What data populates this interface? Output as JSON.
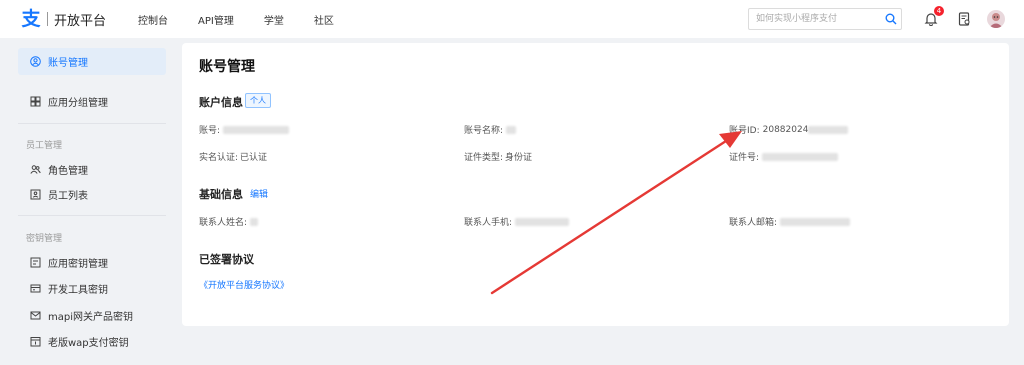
{
  "header": {
    "app_title": "开放平台",
    "nav": [
      "控制台",
      "API管理",
      "学堂",
      "社区"
    ],
    "search_placeholder": "如何实现小程序支付",
    "notification_count": "4",
    "icons": [
      "search-icon",
      "bell-icon",
      "document-icon",
      "avatar"
    ]
  },
  "sidebar": {
    "items_top": [
      {
        "label": "账号管理",
        "icon": "user-circle-icon",
        "active": true
      },
      {
        "label": "应用分组管理",
        "icon": "grid-icon",
        "active": false
      }
    ],
    "group1_title": "员工管理",
    "group1_items": [
      {
        "label": "角色管理",
        "icon": "people-icon"
      },
      {
        "label": "员工列表",
        "icon": "id-card-icon"
      }
    ],
    "group2_title": "密钥管理",
    "group2_items": [
      {
        "label": "应用密钥管理",
        "icon": "key-doc-icon"
      },
      {
        "label": "开发工具密钥",
        "icon": "tool-icon"
      },
      {
        "label": "mapi网关产品密钥",
        "icon": "mail-icon"
      },
      {
        "label": "老版wap支付密钥",
        "icon": "calendar-icon"
      }
    ]
  },
  "main": {
    "title": "账号管理",
    "account_section": {
      "title": "账户信息",
      "tag": "个人",
      "account_label": "账号:",
      "account_name_label": "账号名称:",
      "account_id_label": "账号ID:",
      "account_id_value": "20882024",
      "realname_label": "实名认证:",
      "realname_value": "已认证",
      "cert_type_label": "证件类型:",
      "cert_type_value": "身份证",
      "cert_no_label": "证件号:"
    },
    "basic_section": {
      "title": "基础信息",
      "edit": "编辑",
      "contact_name_label": "联系人姓名:",
      "contact_phone_label": "联系人手机:",
      "contact_email_label": "联系人邮箱:"
    },
    "agreement_section": {
      "title": "已签署协议",
      "link": "《开放平台服务协议》"
    }
  },
  "colors": {
    "accent": "#1677ff",
    "arrow": "#e53935",
    "background": "#f0f2f5"
  }
}
